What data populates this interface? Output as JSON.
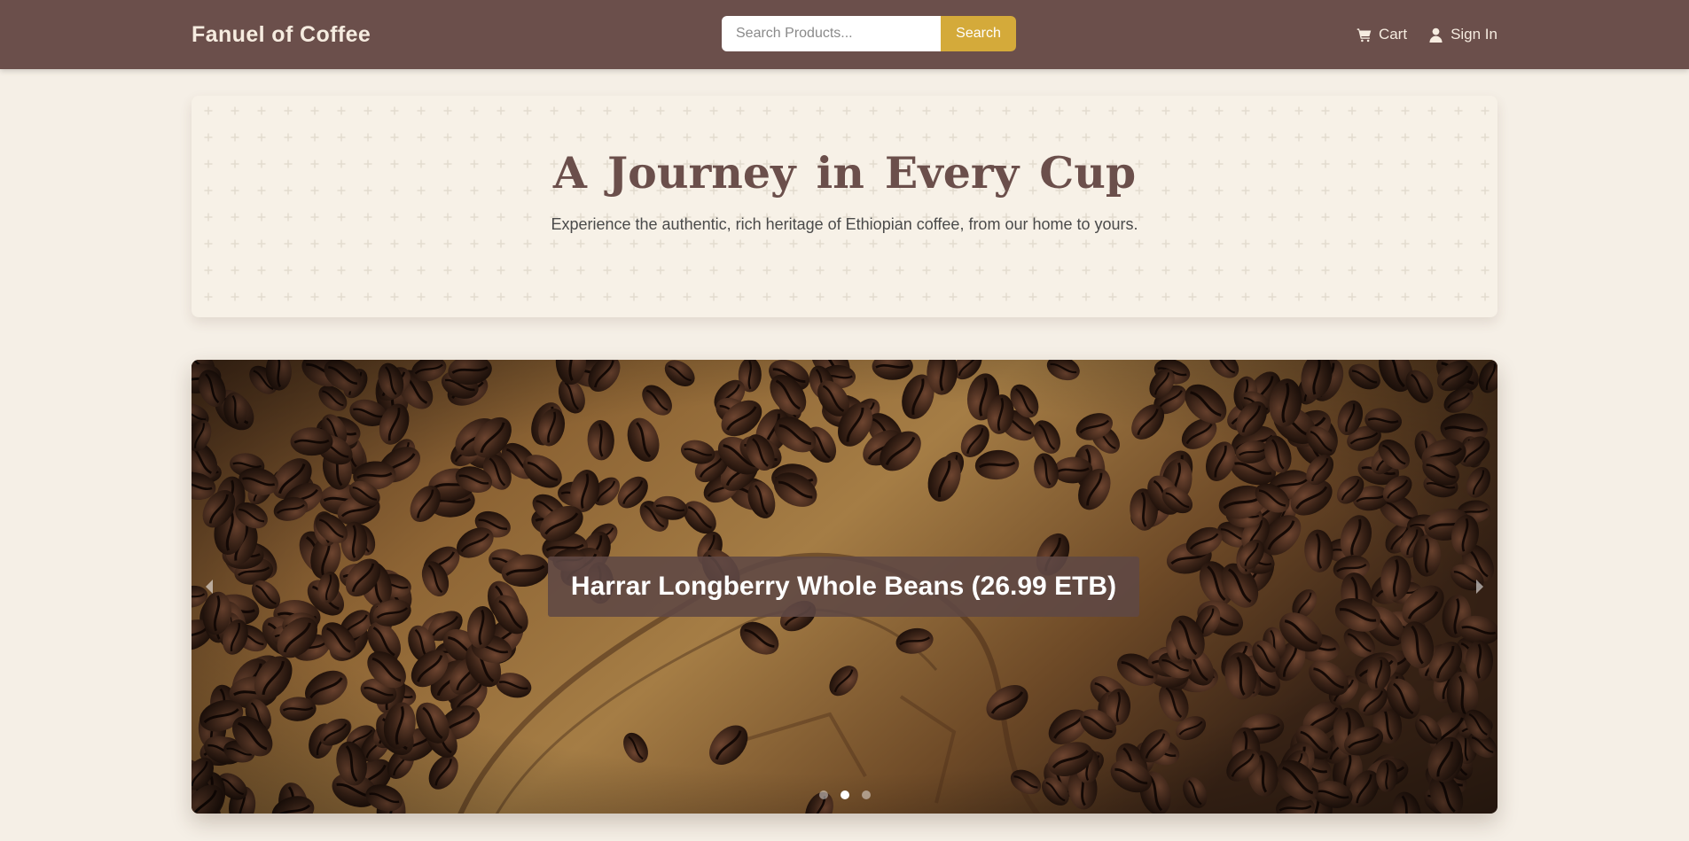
{
  "navbar": {
    "brand": "Fanuel of Coffee",
    "search": {
      "placeholder": "Search Products...",
      "value": "",
      "button_label": "Search"
    },
    "links": [
      {
        "label": "Cart",
        "icon": "cart-icon"
      },
      {
        "label": "Sign In",
        "icon": "user-icon"
      }
    ]
  },
  "hero": {
    "title": "A Journey in Every Cup",
    "subtitle": "Experience the authentic, rich heritage of Ethiopian coffee, from our home to yours."
  },
  "carousel": {
    "caption": "Harrar Longberry Whole Beans (26.99 ETB)",
    "slide_count": 3,
    "active_slide": 2,
    "prev_icon": "chevron-left-icon",
    "next_icon": "chevron-right-icon"
  },
  "colors": {
    "navbar_bg": "#6b4f4b",
    "page_bg": "#f5efe6",
    "accent": "#d4aa3a",
    "brand_text": "#f6ece0",
    "title_color": "#6b4f4b"
  }
}
